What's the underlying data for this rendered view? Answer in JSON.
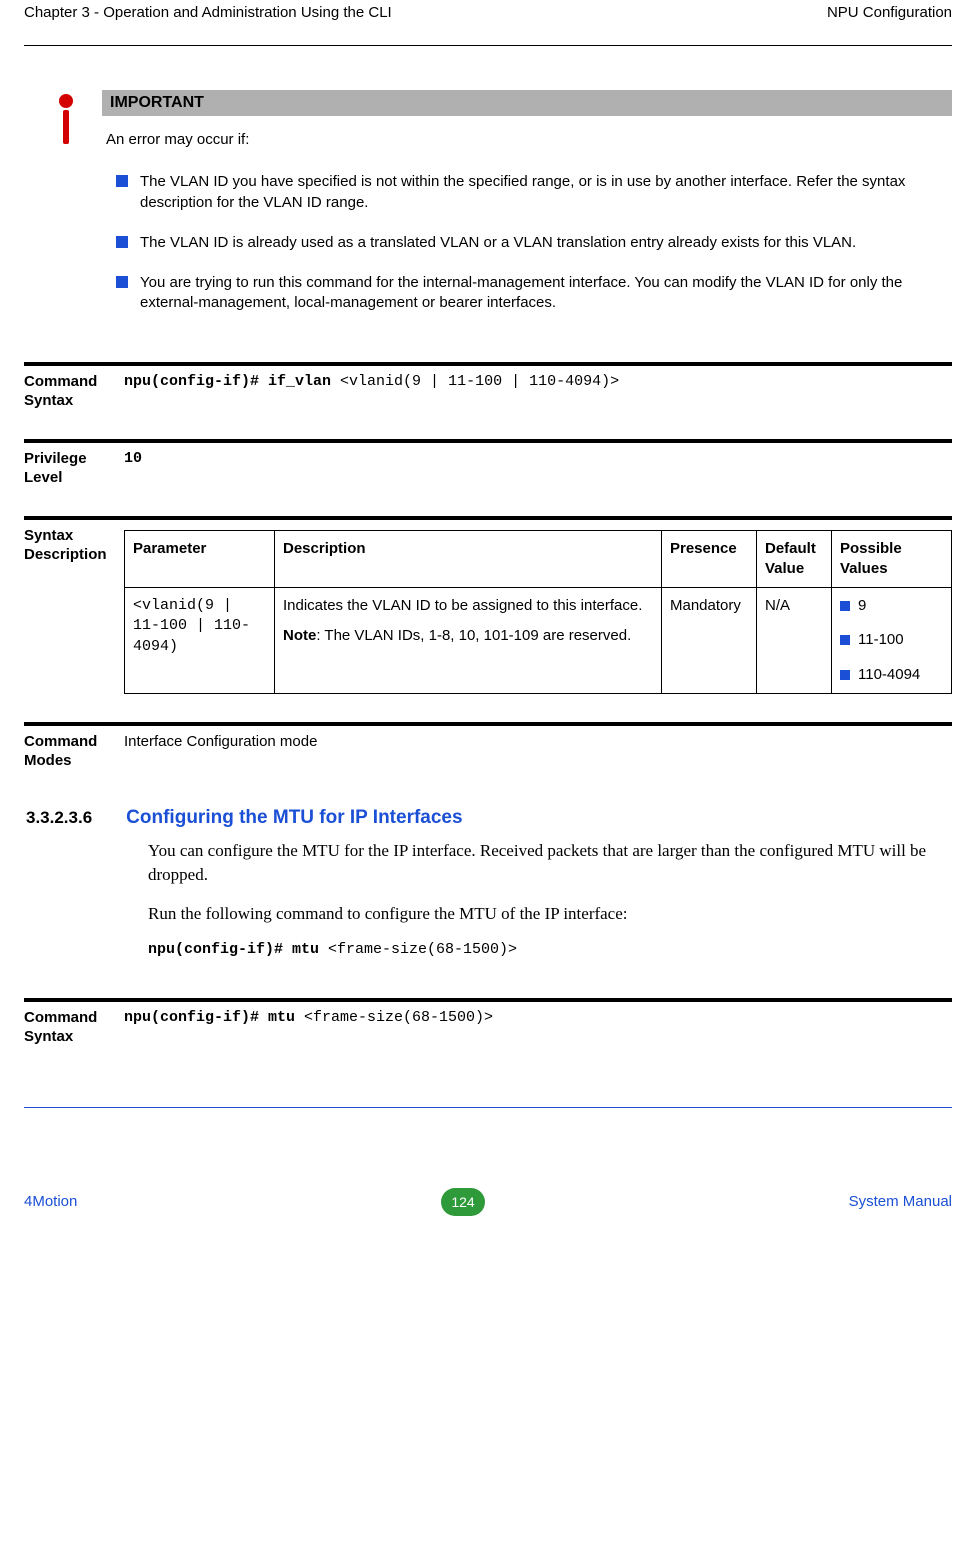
{
  "header": {
    "left": "Chapter 3 - Operation and Administration Using the CLI",
    "right": "NPU Configuration"
  },
  "callout": {
    "title": "IMPORTANT",
    "intro": "An error may occur if:",
    "bullets": [
      "The VLAN ID you have specified is not within the specified range, or is in use by another interface. Refer the syntax description for the VLAN ID range.",
      "The VLAN ID is already used as a translated VLAN or a VLAN translation entry already exists for this VLAN.",
      "You are trying to run this command for the internal-management interface. You can modify the VLAN ID for only the external-management, local-management or bearer interfaces."
    ]
  },
  "defs": {
    "cmd_syntax_label": "Command Syntax",
    "cmd_syntax_bold": "npu(config-if)# if_vlan ",
    "cmd_syntax_rest": "<vlanid(9 | 11-100 | 110-4094)>",
    "priv_label": "Privilege Level",
    "priv_value": "10",
    "syntax_desc_label": "Syntax Description",
    "cmd_modes_label": "Command Modes",
    "cmd_modes_value": "Interface Configuration mode"
  },
  "table": {
    "headers": {
      "parameter": "Parameter",
      "description": "Description",
      "presence": "Presence",
      "default": "Default Value",
      "possible": "Possible Values"
    },
    "row": {
      "parameter": "<vlanid(9 | 11-100 | 110-4094)",
      "desc1": "Indicates the VLAN ID to be assigned to this interface.",
      "desc_note_label": "Note",
      "desc_note_rest": ": The VLAN IDs, 1-8, 10, 101-109 are reserved.",
      "presence": "Mandatory",
      "default": "N/A",
      "pv": [
        "9",
        "11-100",
        "110-4094"
      ]
    }
  },
  "section": {
    "num": "3.3.2.3.6",
    "title": "Configuring the MTU for IP Interfaces",
    "para1": "You can configure the MTU for the IP interface. Received packets that are larger than the configured MTU will be dropped.",
    "para2": "Run the following command to configure the MTU of the IP interface:",
    "cmd_bold": "npu(config-if)# mtu ",
    "cmd_rest": "<frame-size(68-1500)>"
  },
  "defs2": {
    "cmd_syntax_label": "Command Syntax",
    "cmd_bold": "npu(config-if)# mtu ",
    "cmd_rest": "<frame-size(68-1500)>"
  },
  "footer": {
    "left": "4Motion",
    "page": "124",
    "right": "System Manual"
  }
}
